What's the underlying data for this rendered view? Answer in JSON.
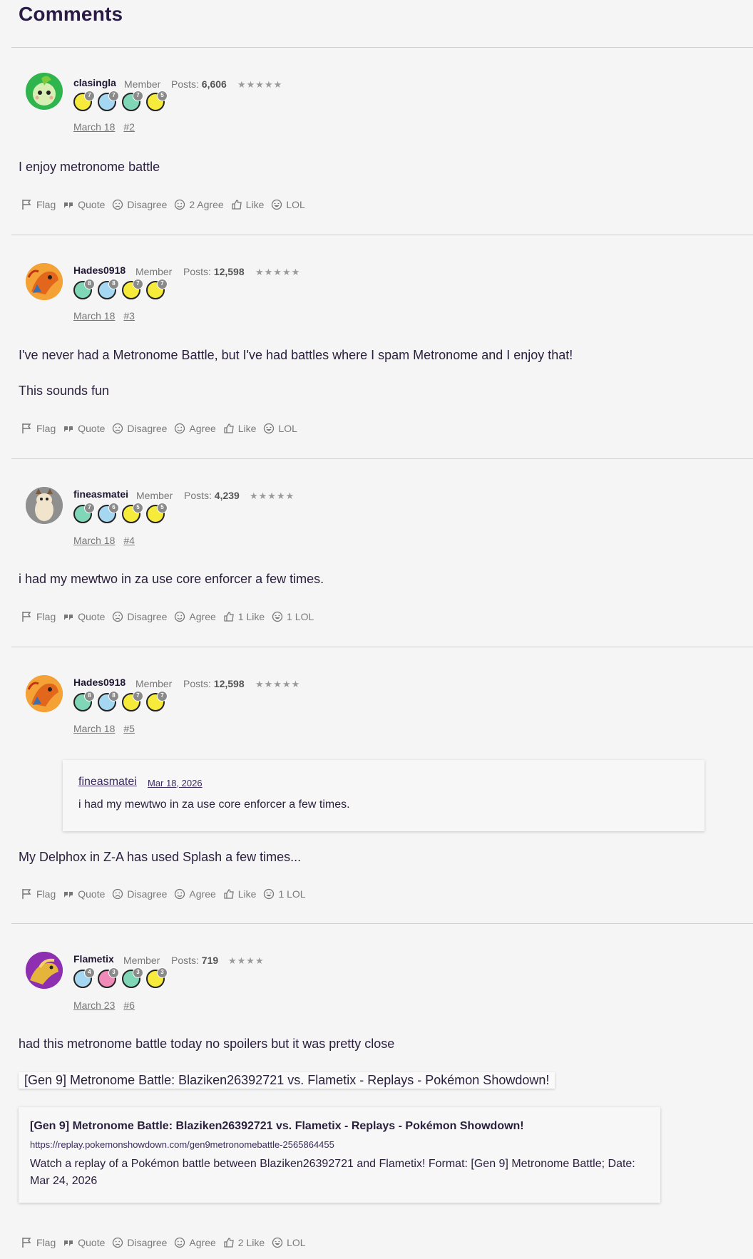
{
  "heading": "Comments",
  "actions_common": {
    "flag": "Flag",
    "quote": "Quote",
    "disagree": "Disagree"
  },
  "posts": [
    {
      "user": "clasingla",
      "role": "Member",
      "posts_label": "Posts:",
      "posts": "6,606",
      "stars": "★★★★★",
      "date": "March 18",
      "num": "#2",
      "text": [
        "I enjoy metronome battle"
      ],
      "agree": "2 Agree",
      "like": "Like",
      "lol": "LOL",
      "badges": [
        {
          "color": "yellow",
          "n": "7"
        },
        {
          "color": "blue",
          "n": "7"
        },
        {
          "color": "green",
          "n": "7"
        },
        {
          "color": "yellow",
          "n": "5"
        }
      ]
    },
    {
      "user": "Hades0918",
      "role": "Member",
      "posts_label": "Posts:",
      "posts": "12,598",
      "stars": "★★★★★",
      "date": "March 18",
      "num": "#3",
      "text": [
        "I've never had a Metronome Battle, but I've had battles where I spam Metronome and I enjoy that!",
        "This sounds fun"
      ],
      "agree": "Agree",
      "like": "Like",
      "lol": "LOL",
      "badges": [
        {
          "color": "green",
          "n": "8"
        },
        {
          "color": "blue",
          "n": "8"
        },
        {
          "color": "yellow",
          "n": "7"
        },
        {
          "color": "yellow",
          "n": "7"
        }
      ]
    },
    {
      "user": "fineasmatei",
      "role": "Member",
      "posts_label": "Posts:",
      "posts": "4,239",
      "stars": "★★★★★",
      "date": "March 18",
      "num": "#4",
      "text": [
        "i had my mewtwo in za use core enforcer a few times."
      ],
      "agree": "Agree",
      "like": "1 Like",
      "lol": "1 LOL",
      "badges": [
        {
          "color": "green",
          "n": "7"
        },
        {
          "color": "blue",
          "n": "6"
        },
        {
          "color": "yellow",
          "n": "5"
        },
        {
          "color": "yellow",
          "n": "5"
        }
      ]
    },
    {
      "user": "Hades0918",
      "role": "Member",
      "posts_label": "Posts:",
      "posts": "12,598",
      "stars": "★★★★★",
      "date": "March 18",
      "num": "#5",
      "quote": {
        "author": "fineasmatei",
        "date": "Mar 18, 2026",
        "text": "i had my mewtwo in za use core enforcer a few times."
      },
      "text": [
        "My Delphox in Z-A has used Splash a few times..."
      ],
      "agree": "Agree",
      "like": "Like",
      "lol": "1 LOL",
      "badges": [
        {
          "color": "green",
          "n": "8"
        },
        {
          "color": "blue",
          "n": "8"
        },
        {
          "color": "yellow",
          "n": "7"
        },
        {
          "color": "yellow",
          "n": "7"
        }
      ]
    },
    {
      "user": "Flametix",
      "role": "Member",
      "posts_label": "Posts:",
      "posts": "719",
      "stars": "★★★★",
      "date": "March 23",
      "num": "#6",
      "text": [
        "had this metronome battle today no spoilers but it was pretty close"
      ],
      "link_inline": "[Gen 9] Metronome Battle: Blaziken26392721 vs. Flametix - Replays - Pokémon Showdown!",
      "card": {
        "title": "[Gen 9] Metronome Battle: Blaziken26392721 vs. Flametix - Replays - Pokémon Showdown!",
        "url": "https://replay.pokemonshowdown.com/gen9metronomebattle-2565864455",
        "desc": "Watch a replay of a Pokémon battle between Blaziken26392721 and Flametix! Format: [Gen 9] Metronome Battle; Date: Mar 24, 2026"
      },
      "agree": "Agree",
      "like": "2 Like",
      "lol": "LOL",
      "badges": [
        {
          "color": "blue",
          "n": "4"
        },
        {
          "color": "pink",
          "n": "3"
        },
        {
          "color": "green",
          "n": "3"
        },
        {
          "color": "yellow",
          "n": "3"
        }
      ]
    }
  ]
}
